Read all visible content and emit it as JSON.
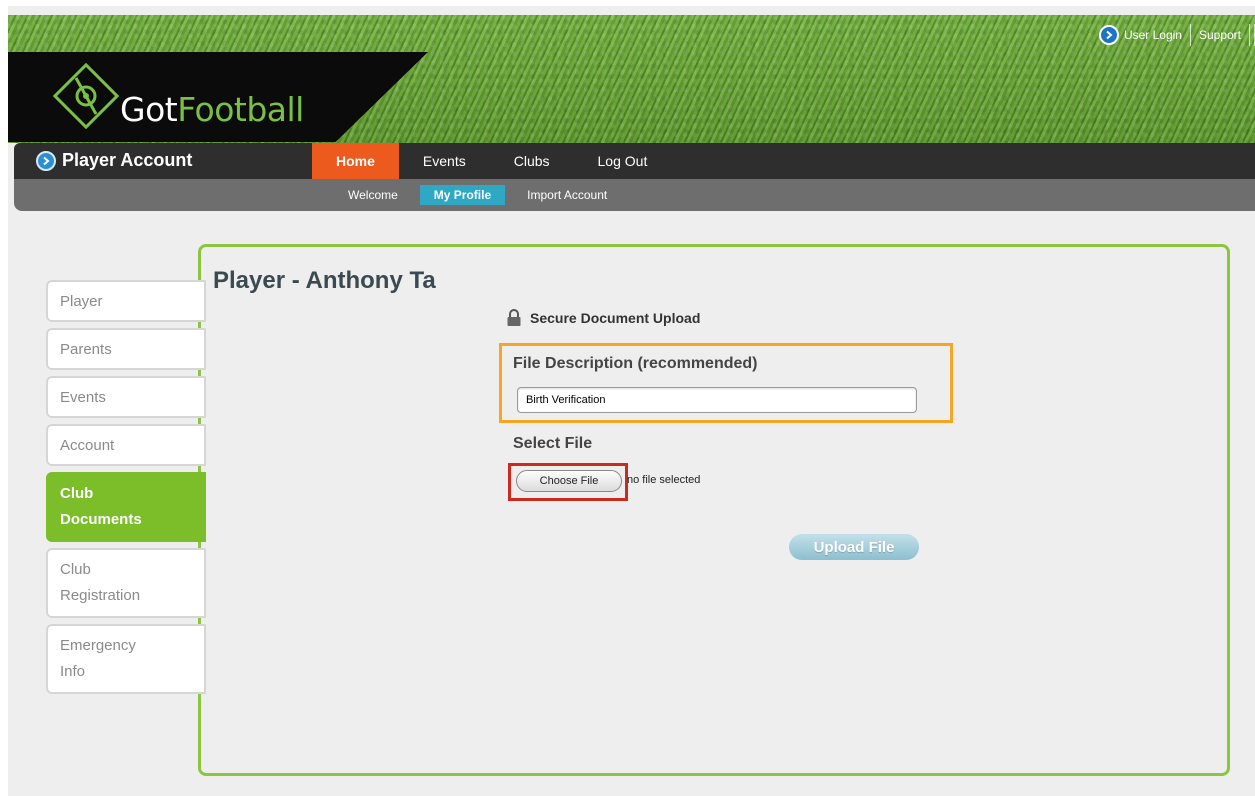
{
  "brand": {
    "logo_got": "Got",
    "logo_football": "Football"
  },
  "toplinks": {
    "login": "User Login",
    "support": "Support"
  },
  "mainnav": {
    "account_title": "Player Account",
    "items": [
      "Home",
      "Events",
      "Clubs",
      "Log Out"
    ],
    "active": "Home"
  },
  "subnav": {
    "items": [
      "Welcome",
      "My Profile",
      "Import Account"
    ],
    "active": "My Profile"
  },
  "sidebar": {
    "tabs": [
      {
        "label": "Player"
      },
      {
        "label": "Parents"
      },
      {
        "label": "Events"
      },
      {
        "label": "Account"
      },
      {
        "label_line1": "Club",
        "label_line2": "Documents"
      },
      {
        "label_line1": "Club",
        "label_line2": "Registration"
      },
      {
        "label_line1": "Emergency",
        "label_line2": "Info"
      }
    ],
    "active": "Club Documents"
  },
  "main": {
    "title": "Player - Anthony Ta",
    "secure_label": "Secure Document Upload",
    "description_label": "File Description (recommended)",
    "description_value": "Birth Verification",
    "select_label": "Select File",
    "choose_button": "Choose File",
    "no_file_text": "no file selected",
    "upload_button": "Upload File"
  },
  "colors": {
    "nav_active": "#ec5a1d",
    "subnav_active": "#2fa8c3",
    "tab_active": "#7cbd2a",
    "panel_border": "#8cc63f",
    "highlight_description": "#f5a623",
    "highlight_choose": "#cc2a1f"
  },
  "icons": {
    "logo": "gotfootball-logo-icon",
    "login": "arrow-circle-icon",
    "account": "arrow-circle-icon",
    "secure": "lock-icon"
  }
}
